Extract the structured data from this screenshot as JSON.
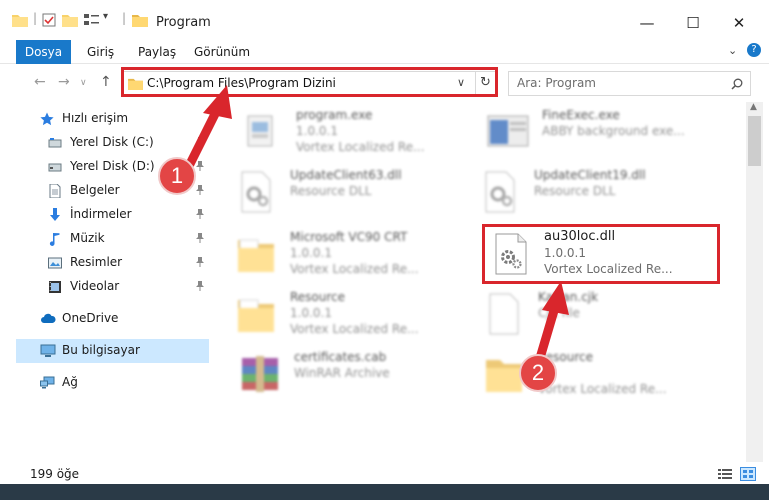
{
  "window": {
    "title": "Program",
    "minimize": "—",
    "maximize": "☐",
    "close": "✕"
  },
  "ribbon": {
    "tabs": [
      "Dosya",
      "Giriş",
      "Paylaş",
      "Görünüm"
    ],
    "help": "?"
  },
  "address": {
    "path": "C:\\Program Files\\Program Dizini",
    "search_placeholder": "Ara: Program"
  },
  "nav": {
    "items": [
      {
        "label": "Hızlı erişim",
        "icon": "star-icon"
      },
      {
        "label": "Yerel Disk (C:)",
        "icon": "drive-icon",
        "pinned": true
      },
      {
        "label": "Yerel Disk (D:)",
        "icon": "drive-icon",
        "pinned": true
      },
      {
        "label": "Belgeler",
        "icon": "document-icon",
        "pinned": true
      },
      {
        "label": "İndirmeler",
        "icon": "download-icon",
        "pinned": true
      },
      {
        "label": "Müzik",
        "icon": "music-icon",
        "pinned": true
      },
      {
        "label": "Resimler",
        "icon": "picture-icon",
        "pinned": true
      },
      {
        "label": "Videolar",
        "icon": "video-icon",
        "pinned": true
      },
      {
        "label": "OneDrive",
        "icon": "cloud-icon"
      },
      {
        "label": "Bu bilgisayar",
        "icon": "computer-icon",
        "selected": true
      },
      {
        "label": "Ağ",
        "icon": "network-icon"
      }
    ]
  },
  "files": [
    {
      "name": "program.exe",
      "version": "1.0.0.1",
      "desc": "Vortex Localized Re...",
      "icon": "exe-icon"
    },
    {
      "name": "FineExec.exe",
      "version": "ABBY background exe...",
      "desc": "",
      "icon": "exe-icon"
    },
    {
      "name": "UpdateClient63.dll",
      "version": "Resource DLL",
      "desc": "",
      "icon": "dll-icon"
    },
    {
      "name": "UpdateClient19.dll",
      "version": "Resource DLL",
      "desc": "",
      "icon": "dll-icon"
    },
    {
      "name": "Microsoft VC90 CRT",
      "version": "1.0.0.1",
      "desc": "Vortex Localized Re...",
      "icon": "folder-icon"
    },
    {
      "name": "au30loc.dll",
      "version": "1.0.0.1",
      "desc": "Vortex Localized Re...",
      "icon": "dll-icon"
    },
    {
      "name": "Resource",
      "version": "1.0.0.1",
      "desc": "Vortex Localized Re...",
      "icon": "folder-icon"
    },
    {
      "name": "Kattan.cjk",
      "version": "CJK file",
      "desc": "",
      "icon": "file-icon"
    },
    {
      "name": "certificates.cab",
      "version": "WinRAR Archive",
      "desc": "",
      "icon": "archive-icon"
    },
    {
      "name": "Resource",
      "version": "",
      "desc": "Vortex Localized Re...",
      "icon": "folder-icon"
    }
  ],
  "status": {
    "count": "199 öğe"
  },
  "annotations": {
    "step1": "1",
    "step2": "2"
  },
  "colors": {
    "accent": "#1979ca",
    "highlight": "#d9262c",
    "badge": "#e34545"
  }
}
